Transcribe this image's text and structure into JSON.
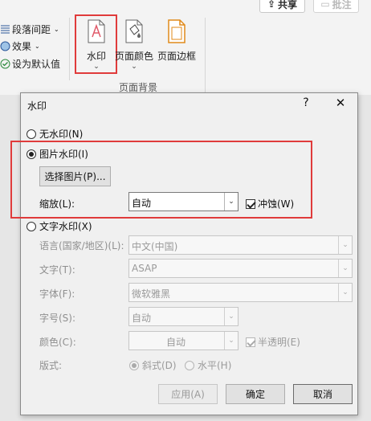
{
  "ribbon": {
    "share_label": "共享",
    "comment_label": "批注",
    "paragraph_spacing": "段落间距",
    "effects": "效果",
    "set_default": "设为默认值",
    "watermark": "水印",
    "page_color": "页面颜色",
    "page_border": "页面边框",
    "group_label": "页面背景"
  },
  "dialog": {
    "title": "水印",
    "help": "?",
    "close": "✕",
    "no_watermark": "无水印(N)",
    "picture_watermark": "图片水印(I)",
    "select_picture": "选择图片(P)...",
    "scale_label": "缩放(L):",
    "scale_value": "自动",
    "washout": "冲蚀(W)",
    "text_watermark": "文字水印(X)",
    "language_label": "语言(国家/地区)(L):",
    "language_value": "中文(中国)",
    "text_label": "文字(T):",
    "text_value": "ASAP",
    "font_label": "字体(F):",
    "font_value": "微软雅黑",
    "size_label": "字号(S):",
    "size_value": "自动",
    "color_label": "颜色(C):",
    "color_value": "自动",
    "semitransparent": "半透明(E)",
    "layout_label": "版式:",
    "diagonal": "斜式(D)",
    "horizontal": "水平(H)",
    "apply": "应用(A)",
    "ok": "确定",
    "cancel": "取消"
  },
  "colors": {
    "highlight": "#e03b3b",
    "watermark_icon": "#e05a6a",
    "border_icon": "#e08a1a"
  }
}
